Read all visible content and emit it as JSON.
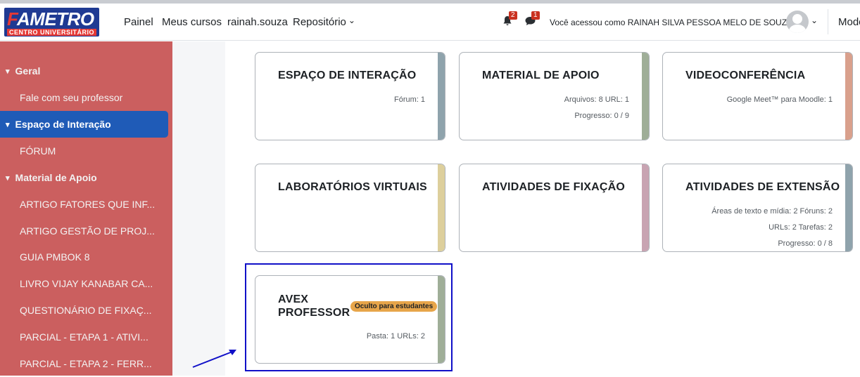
{
  "logo": {
    "main_prefix": "F",
    "main_rest": "AMETRO",
    "sub": "CENTRO UNIVERSITÁRIO"
  },
  "nav": {
    "links": [
      "Painel",
      "Meus cursos",
      "rainah.souza",
      "Repositório"
    ],
    "notifications_count": "2",
    "messages_count": "1",
    "user_text": "Você acessou como RAINAH SILVA PESSOA MELO DE SOUZA",
    "mode_text": "Modo"
  },
  "sidebar": {
    "items": [
      {
        "label": "Geral",
        "kind": "section"
      },
      {
        "label": "Fale com seu professor",
        "kind": "sub"
      },
      {
        "label": "Espaço de Interação",
        "kind": "section",
        "active": true
      },
      {
        "label": "FÓRUM",
        "kind": "sub"
      },
      {
        "label": "Material de Apoio",
        "kind": "section"
      },
      {
        "label": "ARTIGO FATORES QUE INF...",
        "kind": "sub"
      },
      {
        "label": "ARTIGO GESTÃO DE PROJ...",
        "kind": "sub"
      },
      {
        "label": "GUIA PMBOK 8",
        "kind": "sub"
      },
      {
        "label": "LIVRO VIJAY KANABAR CA...",
        "kind": "sub"
      },
      {
        "label": "QUESTIONÁRIO DE FIXAÇ...",
        "kind": "sub"
      },
      {
        "label": "PARCIAL - ETAPA 1 - ATIVI...",
        "kind": "sub"
      },
      {
        "label": "PARCIAL - ETAPA 2 - FERR...",
        "kind": "sub"
      }
    ]
  },
  "cards": [
    {
      "title": "ESPAÇO DE INTERAÇÃO",
      "meta": [
        "Fórum: 1"
      ],
      "stripe_color": "#8fa3ac"
    },
    {
      "title": "MATERIAL DE APOIO",
      "meta": [
        "Arquivos: 8   URL: 1",
        "Progresso: 0 / 9"
      ],
      "stripe_color": "#9fae98"
    },
    {
      "title": "VIDEOCONFERÊNCIA",
      "meta": [
        "Google Meet™ para Moodle: 1"
      ],
      "stripe_color": "#d9a08c"
    },
    {
      "title": "LABORATÓRIOS VIRTUAIS",
      "meta": [],
      "stripe_color": "#ddcf9c"
    },
    {
      "title": "ATIVIDADES DE FIXAÇÃO",
      "meta": [],
      "stripe_color": "#c8a4b2"
    },
    {
      "title": "ATIVIDADES DE EXTENSÃO",
      "meta": [
        "Áreas de texto e mídia: 2   Fóruns: 2",
        "URLs: 2   Tarefas: 2",
        "Progresso: 0 / 8"
      ],
      "stripe_color": "#8fa3ac"
    },
    {
      "title_line1": "AVEX",
      "title_line2": "PROFESSOR",
      "badge": "Oculto para estudantes",
      "meta": [
        "Pasta: 1   URLs: 2"
      ],
      "stripe_color": "#9fae98"
    }
  ]
}
